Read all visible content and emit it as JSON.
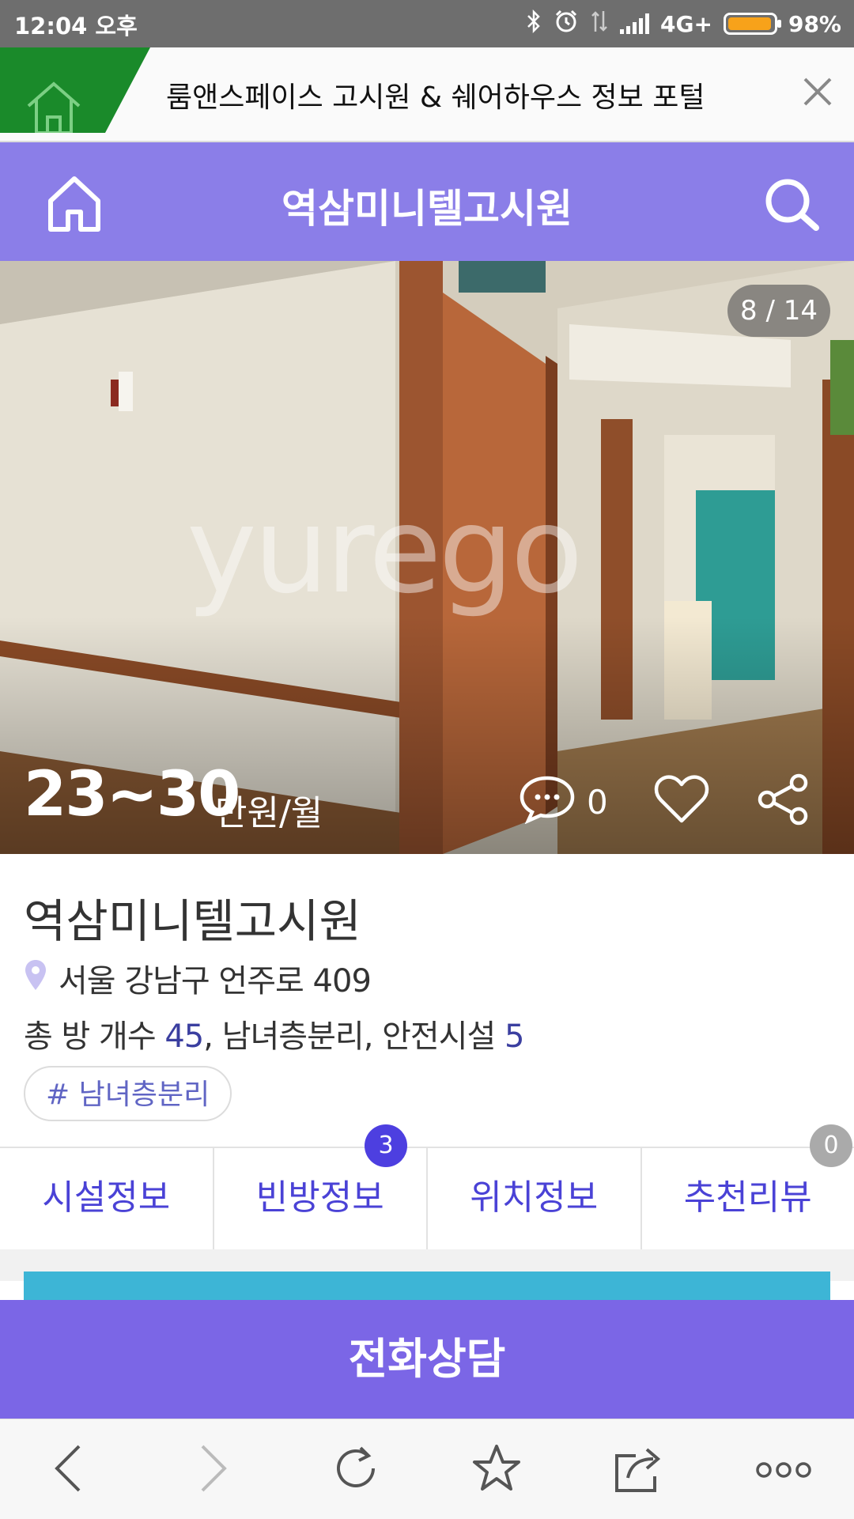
{
  "status_bar": {
    "time": "12:04 오후",
    "network": "4G+",
    "battery": "98%"
  },
  "portal_banner": {
    "title": "룸앤스페이스 고시원 & 쉐어하우스 정보 포털"
  },
  "header": {
    "title": "역삼미니텔고시원"
  },
  "photo": {
    "counter": "8 / 14",
    "watermark": "yurego"
  },
  "price": {
    "value": "23~30",
    "unit": "만원/월"
  },
  "comments": {
    "count": "0"
  },
  "listing": {
    "name": "역삼미니텔고시원",
    "address": "서울 강남구 언주로 409",
    "stats_label_rooms": "총 방 개수",
    "rooms": "45",
    "gender_sep": ", 남녀층분리, 안전시설",
    "safety": "5",
    "tag": "# 남녀층분리"
  },
  "tabs": [
    {
      "label": "시설정보"
    },
    {
      "label": "빈방정보",
      "badge": "3"
    },
    {
      "label": "위치정보"
    },
    {
      "label": "추천리뷰",
      "badge": "0"
    }
  ],
  "cta": {
    "label": "전화상담"
  },
  "colors": {
    "header": "#8b7ee8",
    "cta": "#7b66e6",
    "tab_text": "#4a42d6",
    "portal_green": "#1a8a2a"
  }
}
